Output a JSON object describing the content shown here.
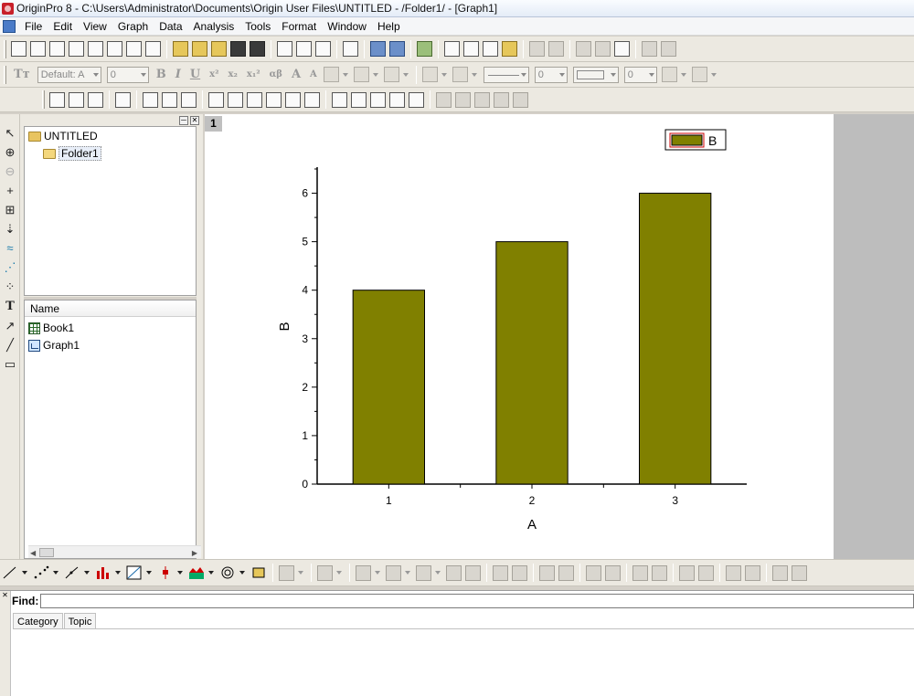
{
  "window": {
    "title": "OriginPro 8 - C:\\Users\\Administrator\\Documents\\Origin User Files\\UNTITLED - /Folder1/ - [Graph1]"
  },
  "menu": [
    "File",
    "Edit",
    "View",
    "Graph",
    "Data",
    "Analysis",
    "Tools",
    "Format",
    "Window",
    "Help"
  ],
  "format_toolbar": {
    "font_value": "Default: A",
    "font_size": "0",
    "line_width": "0",
    "border_width": "0",
    "glyphs": [
      "B",
      "I",
      "U",
      "x²",
      "x₂",
      "x₁²",
      "αβ",
      "A",
      "A"
    ]
  },
  "explorer": {
    "tree": {
      "root": "UNTITLED",
      "child": "Folder1"
    },
    "list_header": "Name",
    "items": [
      "Book1",
      "Graph1"
    ]
  },
  "graph": {
    "layer_number": "1",
    "legend_label": "B"
  },
  "chart_data": {
    "type": "bar",
    "categories": [
      "1",
      "2",
      "3"
    ],
    "values": [
      4,
      5,
      6
    ],
    "xlabel": "A",
    "ylabel": "B",
    "ylim": [
      0,
      6.5
    ],
    "yticks": [
      "0",
      "1",
      "2",
      "3",
      "4",
      "5",
      "6"
    ],
    "series": [
      {
        "name": "B",
        "values": [
          4,
          5,
          6
        ]
      }
    ],
    "bar_color": "#808000",
    "grid": false,
    "legend_placement": "top-right"
  },
  "find": {
    "label": "Find:",
    "value": "",
    "tabs": [
      "Category",
      "Topic"
    ]
  },
  "colors": {
    "bar_fill": "#808000",
    "legend_border": "#cc0000"
  }
}
